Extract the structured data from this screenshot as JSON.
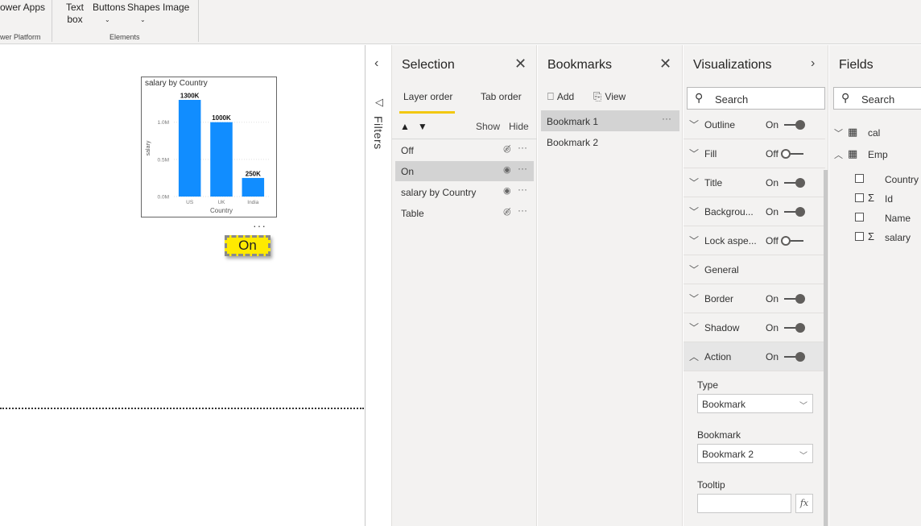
{
  "ribbon": {
    "power_apps": "ower Apps",
    "power_platform": "wer Platform",
    "text_box_line1": "Text",
    "text_box_line2": "box",
    "buttons": "Buttons",
    "shapes": "Shapes",
    "image": "Image",
    "elements_label": "Elements"
  },
  "canvas": {
    "chart_title": "salary by Country",
    "on_button_label": "On"
  },
  "chart_data": {
    "type": "bar",
    "title": "salary by Country",
    "xlabel": "Country",
    "ylabel": "salary",
    "categories": [
      "US",
      "UK",
      "India"
    ],
    "values": [
      1300000,
      1000000,
      250000
    ],
    "data_labels": [
      "1300K",
      "1000K",
      "250K"
    ],
    "y_ticks": [
      0,
      500000,
      1000000
    ],
    "y_tick_labels": [
      "0.0M",
      "0.5M",
      "1.0M"
    ],
    "ylim": [
      0,
      1300000
    ],
    "grid": true,
    "bar_color": "#118dff"
  },
  "filters": {
    "label": "Filters"
  },
  "selection": {
    "title": "Selection",
    "tab_layer": "Layer order",
    "tab_order": "Tab order",
    "show": "Show",
    "hide": "Hide",
    "layers": [
      {
        "name": "Off",
        "visible": false
      },
      {
        "name": "On",
        "visible": true
      },
      {
        "name": "salary by Country",
        "visible": true
      },
      {
        "name": "Table",
        "visible": false
      }
    ]
  },
  "bookmarks": {
    "title": "Bookmarks",
    "add": "Add",
    "view": "View",
    "items": [
      "Bookmark 1",
      "Bookmark 2"
    ]
  },
  "visualizations": {
    "title": "Visualizations",
    "search_placeholder": "Search",
    "properties": [
      {
        "name": "Outline",
        "state": "On"
      },
      {
        "name": "Fill",
        "state": "Off"
      },
      {
        "name": "Title",
        "state": "On"
      },
      {
        "name": "Backgrou...",
        "state": "On"
      },
      {
        "name": "Lock aspe...",
        "state": "Off"
      },
      {
        "name": "General",
        "state": ""
      },
      {
        "name": "Border",
        "state": "On"
      },
      {
        "name": "Shadow",
        "state": "On"
      },
      {
        "name": "Action",
        "state": "On"
      }
    ],
    "action": {
      "type_label": "Type",
      "type_value": "Bookmark",
      "bookmark_label": "Bookmark",
      "bookmark_value": "Bookmark 2",
      "tooltip_label": "Tooltip",
      "fx": "fx"
    }
  },
  "fields": {
    "title": "Fields",
    "search_placeholder": "Search",
    "tables": [
      {
        "name": "cal"
      },
      {
        "name": "Emp"
      }
    ],
    "emp_fields": [
      {
        "name": "Country",
        "sigma": false
      },
      {
        "name": "Id",
        "sigma": true
      },
      {
        "name": "Name",
        "sigma": false
      },
      {
        "name": "salary",
        "sigma": true
      }
    ]
  }
}
